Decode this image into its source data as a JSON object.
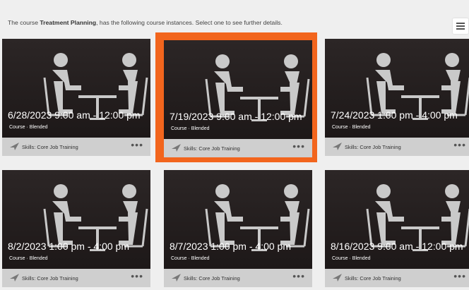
{
  "intro": {
    "before": "The course ",
    "course_name": "Treatment Planning",
    "after": ", has the following course instances. Select one to see further details."
  },
  "menu": {
    "icon": "hamburger-menu-icon"
  },
  "selected_index": 1,
  "cards": [
    {
      "title": "6/28/2023 9:00 am - 12:00 pm",
      "type": "Course · Blended",
      "skills": "Skills: Core Job Training",
      "more": "•••"
    },
    {
      "title": "7/19/2023 9:00 am - 12:00 pm",
      "type": "Course · Blended",
      "skills": "Skills: Core Job Training",
      "more": "•••"
    },
    {
      "title": "7/24/2023 1:00 pm - 4:00 pm",
      "type": "Course · Blended",
      "skills": "Skills: Core Job Training",
      "more": "•••"
    },
    {
      "title": "8/2/2023 1:00 pm - 4:00 pm",
      "type": "Course · Blended",
      "skills": "Skills: Core Job Training",
      "more": "•••"
    },
    {
      "title": "8/7/2023 1:00 pm - 4:00 pm",
      "type": "Course · Blended",
      "skills": "Skills: Core Job Training",
      "more": "•••"
    },
    {
      "title": "8/16/2023 9:00 am - 12:00 pm",
      "type": "Course · Blended",
      "skills": "Skills: Core Job Training",
      "more": "•••"
    }
  ],
  "colors": {
    "selection": "#f2651d",
    "footer": "#cfcfcf",
    "image_bg": "#231d1d"
  }
}
